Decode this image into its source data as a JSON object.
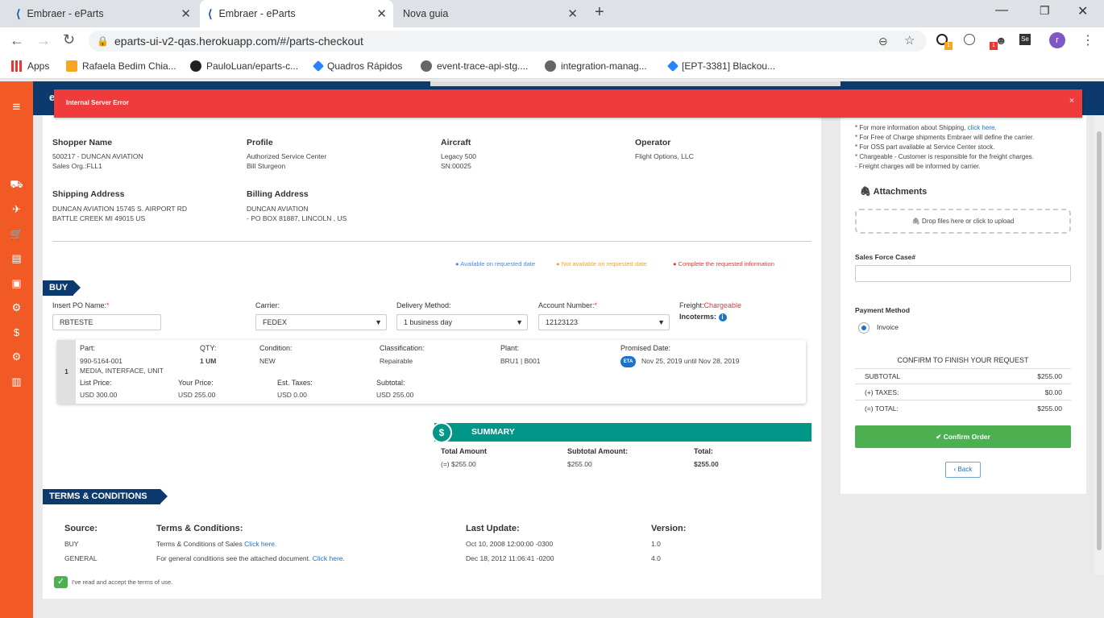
{
  "browser": {
    "tabs": [
      {
        "label": "Embraer - eParts"
      },
      {
        "label": "Embraer - eParts"
      },
      {
        "label": "Nova guia"
      }
    ],
    "url": "eparts-ui-v2-qas.herokuapp.com/#/parts-checkout",
    "ext_badge_1": "1",
    "ext_badge_2": "1",
    "ext_se": "Se",
    "profile": "r",
    "bookmarks": [
      "Apps",
      "Rafaela Bedim Chia...",
      "PauloLuan/eparts-c...",
      "Quadros Rápidos",
      "event-trace-api-stg....",
      "integration-manag...",
      "[EPT-3381] Blackou..."
    ]
  },
  "app": {
    "header_letter": "e"
  },
  "error": {
    "message": "Internal Server Error",
    "close": "×"
  },
  "order": {
    "shopper": {
      "label": "Shopper Name",
      "line1": "500217 - DUNCAN AVIATION",
      "line2": "Sales Org.:FLL1"
    },
    "profile": {
      "label": "Profile",
      "line1": "Authorized Service Center",
      "line2": "Bill Sturgeon"
    },
    "aircraft": {
      "label": "Aircraft",
      "line1": "Legacy 500",
      "line2": "SN:00025"
    },
    "operator": {
      "label": "Operator",
      "line1": "Flight Options, LLC"
    },
    "shipping": {
      "label": "Shipping Address",
      "line1": "DUNCAN AVIATION 15745 S. AIRPORT RD",
      "line2": "BATTLE CREEK MI 49015 US"
    },
    "billing": {
      "label": "Billing Address",
      "line1": "DUNCAN AVIATION",
      "line2": "- PO BOX 81887, LINCOLN , US"
    },
    "legend": {
      "available": "Available on requested date",
      "not_available": "Not available on requested date",
      "complete": "Complete the requested information"
    },
    "colors": {
      "available": "#4a86e8",
      "not_available": "#f5a623",
      "complete": "#e53935",
      "brand": "#0d3a6e",
      "accent": "#f15a24",
      "summary": "#009688",
      "confirm": "#4caf50"
    }
  },
  "buy": {
    "title": "BUY",
    "po_label": "Insert PO Name:",
    "po_value": "RBTESTE",
    "carrier_label": "Carrier:",
    "carrier_value": "FEDEX",
    "delivery_label": "Delivery Method:",
    "delivery_value": "1 business day",
    "account_label": "Account Number:",
    "account_value": "12123123",
    "freight_label": "Freight:",
    "freight_value": "Chargeable",
    "incoterms_label": "Incoterms:",
    "required": "*"
  },
  "item": {
    "index": "1",
    "part_label": "Part:",
    "part_no": "990-5164-001",
    "part_desc": "MEDIA, INTERFACE, UNIT",
    "qty_label": "QTY:",
    "qty_value": "1 UM",
    "condition_label": "Condition:",
    "condition_value": "NEW",
    "class_label": "Classification:",
    "class_value": "Repairable",
    "plant_label": "Plant:",
    "plant_value": "BRU1 | B001",
    "promised_label": "Promised Date:",
    "eta": "ETA",
    "promised_value": "Nov 25, 2019 until Nov 28, 2019",
    "list_label": "List Price:",
    "list_value": "USD 300.00",
    "your_label": "Your Price:",
    "your_value": "USD 255.00",
    "taxes_label": "Est. Taxes:",
    "taxes_value": "USD 0.00",
    "subtotal_label": "Subtotal:",
    "subtotal_value": "USD 255.00"
  },
  "summary": {
    "icon": "$",
    "title": "SUMMARY",
    "total_amount_label": "Total Amount",
    "total_amount_value": "(=) $255.00",
    "subtotal_label": "Subtotal Amount:",
    "subtotal_value": "$255.00",
    "total_label": "Total:",
    "total_value": "$255.00"
  },
  "terms": {
    "title": "TERMS & CONDITIONS",
    "headers": [
      "Source:",
      "Terms & Conditions:",
      "Last Update:",
      "Version:"
    ],
    "rows": [
      {
        "source": "BUY",
        "text": "Terms & Conditions of Sales",
        "link": "Click here.",
        "updated": "Oct 10, 2008 12:00:00 -0300",
        "version": "1.0"
      },
      {
        "source": "GENERAL",
        "text": "For general conditions see the attached document.",
        "link": "Click here.",
        "updated": "Dec 18, 2012 11:06:41 -0200",
        "version": "4.0"
      }
    ],
    "accept": "I've read and accept the terms of use."
  },
  "right": {
    "notes": [
      "* For more information about Shipping,",
      "* For Free of Charge shipments Embraer will define the carrier.",
      "* For OSS part available at Service Center stock.",
      "* Chargeable - Customer is responsible for the freight charges.",
      "- Freight charges will be informed by carrier."
    ],
    "click_here": "click here.",
    "attachments": "Attachments",
    "drop": "Drop files here or click to upload",
    "sfc_label": "Sales Force Case#",
    "sfc_value": "",
    "payment_label": "Payment Method",
    "payment_value": "Invoice",
    "confirm_title": "CONFIRM TO FINISH YOUR REQUEST",
    "subtotal_label": "SUBTOTAL",
    "subtotal_value": "$255.00",
    "taxes_label": "(+) TAXES:",
    "taxes_value": "$0.00",
    "total_label": "(=) TOTAL:",
    "total_value": "$255.00",
    "confirm_btn": "Confirm Order",
    "back_btn": "Back"
  }
}
